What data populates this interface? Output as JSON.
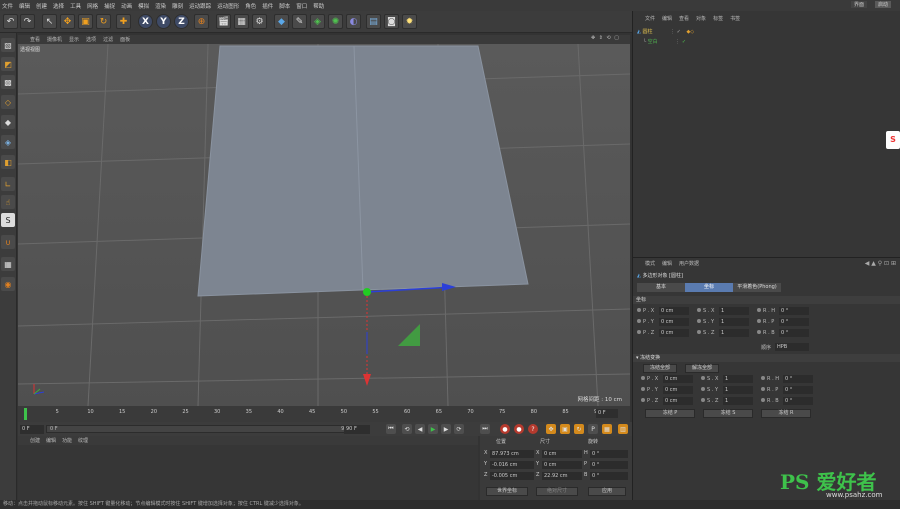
{
  "menubar": {
    "items": [
      "文件",
      "编辑",
      "创建",
      "选择",
      "工具",
      "网格",
      "捕捉",
      "动画",
      "模拟",
      "渲染",
      "雕刻",
      "运动跟踪",
      "运动图形",
      "角色",
      "插件",
      "脚本",
      "窗口",
      "帮助"
    ],
    "right": [
      "界面",
      "启动"
    ]
  },
  "toolbar": {
    "icons": [
      "undo-icon",
      "redo-icon",
      "select-icon",
      "move-icon",
      "scale-icon",
      "rotate-icon",
      "add-icon",
      "x-axis-icon",
      "y-axis-icon",
      "z-axis-icon",
      "world-icon",
      "render-view-icon",
      "render-icon",
      "render-settings-icon",
      "cube-icon",
      "pen-icon",
      "subdivide-icon",
      "cloner-icon",
      "deformer-icon",
      "floor-icon",
      "camera-icon",
      "light-icon"
    ],
    "axes": [
      "X",
      "Y",
      "Z"
    ]
  },
  "viewport": {
    "menu": [
      "查看",
      "摄像机",
      "显示",
      "选项",
      "过滤",
      "面板"
    ],
    "nav": "✥ ⇕ ⟲ ▢",
    "title": "透视视图",
    "grid_info": "网格间距 : 10 cm",
    "plane_color": "#7d8591",
    "grid_color": "#6a6a6a"
  },
  "timeline": {
    "ticks": [
      "0",
      "5",
      "10",
      "15",
      "20",
      "25",
      "30",
      "35",
      "40",
      "45",
      "50",
      "55",
      "60",
      "65",
      "70",
      "75",
      "80",
      "85",
      "90"
    ],
    "end_frame": "0 F"
  },
  "playback": {
    "start": "0 F",
    "slider_left": "0 F",
    "slider_right": "90 F",
    "end": "90 F"
  },
  "material": {
    "menu": [
      "创建",
      "编辑",
      "功能",
      "纹理"
    ]
  },
  "coords": {
    "headers": [
      "位置",
      "尺寸",
      "旋转"
    ],
    "rows": [
      {
        "axis": "X",
        "pos": "87.973 cm",
        "size_axis": "X",
        "size": "0 cm",
        "rot_axis": "H",
        "rot": "0 °"
      },
      {
        "axis": "Y",
        "pos": "-0.016 cm",
        "size_axis": "Y",
        "size": "0 cm",
        "rot_axis": "P",
        "rot": "0 °"
      },
      {
        "axis": "Z",
        "pos": "-0.005 cm",
        "size_axis": "Z",
        "size": "22.92 cm",
        "rot_axis": "B",
        "rot": "0 °"
      }
    ],
    "mode": "世界坐标",
    "size_mode": "绝对尺寸",
    "apply": "应用"
  },
  "objects": {
    "menu": [
      "文件",
      "编辑",
      "查看",
      "对象",
      "标签",
      "书签"
    ],
    "items": [
      {
        "name": "圆柱",
        "indent": 0,
        "color": "#e0c050"
      },
      {
        "name": "空白",
        "indent": 1,
        "color": "#4fb04f"
      }
    ]
  },
  "attributes": {
    "menu": [
      "模式",
      "编辑",
      "用户数据"
    ],
    "title": "多边形对象 [圆柱]",
    "tabs": [
      "基本",
      "坐标",
      "平滑着色(Phong)"
    ],
    "section_coords": "坐标",
    "p_rows": [
      {
        "l": "P . X",
        "v": "0 cm",
        "sl": "S . X",
        "sv": "1",
        "rl": "R . H",
        "rv": "0 °"
      },
      {
        "l": "P . Y",
        "v": "0 cm",
        "sl": "S . Y",
        "sv": "1",
        "rl": "R . P",
        "rv": "0 °"
      },
      {
        "l": "P . Z",
        "v": "0 cm",
        "sl": "S . Z",
        "sv": "1",
        "rl": "R . B",
        "rv": "0 °"
      }
    ],
    "order_label": "顺序",
    "order_value": "HPB",
    "section_freeze": "▾ 冻结变换",
    "freeze_all": "冻结全部",
    "unfreeze_all": "解冻全部",
    "f_rows": [
      {
        "l": "P . X",
        "v": "0 cm",
        "sl": "S . X",
        "sv": "1",
        "rl": "R . H",
        "rv": "0 °"
      },
      {
        "l": "P . Y",
        "v": "0 cm",
        "sl": "S . Y",
        "sv": "1",
        "rl": "R . P",
        "rv": "0 °"
      },
      {
        "l": "P . Z",
        "v": "0 cm",
        "sl": "S . Z",
        "sv": "1",
        "rl": "R . B",
        "rv": "0 °"
      }
    ],
    "freeze_p": "冻结 P",
    "freeze_s": "冻结 S",
    "freeze_r": "冻结 R"
  },
  "status": "移动：点击并拖动鼠标移动元素。按住 SHIFT 键量化移动；节点编辑模式时按住 SHIFT 键增加选择对象；按住 CTRL 键减少选择对象。",
  "watermark": {
    "main": "PS 爱好者",
    "sub": "www.psahz.com"
  },
  "side_logo": "S"
}
